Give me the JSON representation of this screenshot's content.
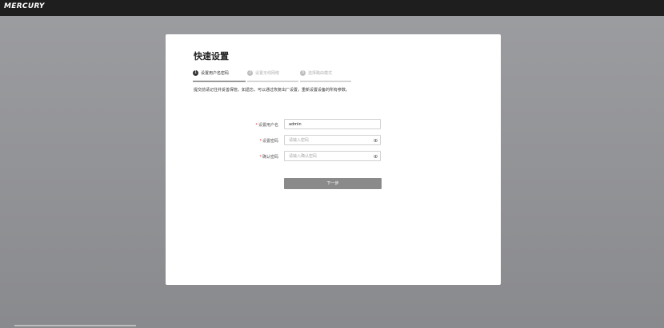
{
  "header": {
    "logo_text": "MERCURY"
  },
  "card": {
    "title": "快速设置",
    "steps": [
      {
        "num": "1",
        "label": "设置用户名密码",
        "active": true
      },
      {
        "num": "2",
        "label": "设置无线网络",
        "active": false
      },
      {
        "num": "3",
        "label": "选择路由模式",
        "active": false
      }
    ],
    "description": "提交前请记住并妥善保管。如遗忘，可以通过恢复出厂设置，重新设置设备的所有参数。",
    "form": {
      "username": {
        "label": "设置用户名",
        "required_mark": "*",
        "value": "admin"
      },
      "password": {
        "label": "设置密码",
        "required_mark": "*",
        "placeholder": "请输入密码",
        "icon": "eye-icon"
      },
      "confirm": {
        "label": "确认密码",
        "required_mark": "*",
        "placeholder": "请输入确认密码",
        "icon": "eye-icon"
      }
    },
    "next_button": "下一步"
  },
  "colors": {
    "topbar": "#1e1e1e",
    "button": "#8a8a8a",
    "background": "#909194"
  }
}
